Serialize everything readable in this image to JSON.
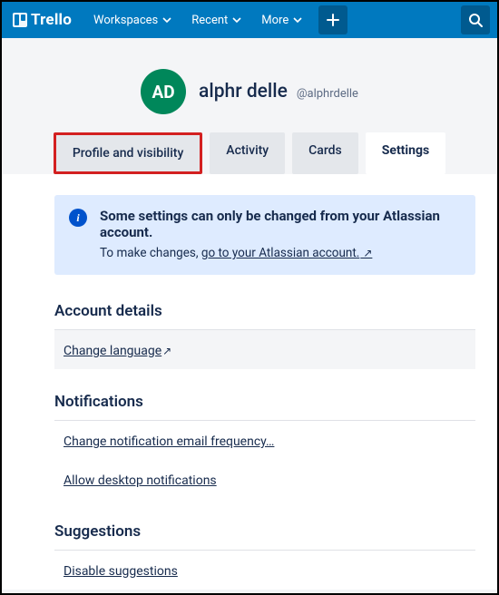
{
  "header": {
    "brand": "Trello",
    "nav": [
      "Workspaces",
      "Recent",
      "More"
    ]
  },
  "profile": {
    "initials": "AD",
    "display_name": "alphr delle",
    "handle": "@alphrdelle"
  },
  "tabs": [
    {
      "label": "Profile and visibility",
      "active": false,
      "highlighted": true
    },
    {
      "label": "Activity",
      "active": false
    },
    {
      "label": "Cards",
      "active": false
    },
    {
      "label": "Settings",
      "active": true
    }
  ],
  "banner": {
    "title": "Some settings can only be changed from your Atlassian account.",
    "prefix": "To make changes, ",
    "link_text": "go to your Atlassian account."
  },
  "sections": {
    "account": {
      "title": "Account details",
      "links": [
        "Change language"
      ]
    },
    "notifications": {
      "title": "Notifications",
      "links": [
        "Change notification email frequency…",
        "Allow desktop notifications"
      ]
    },
    "suggestions": {
      "title": "Suggestions",
      "links": [
        "Disable suggestions"
      ]
    }
  }
}
